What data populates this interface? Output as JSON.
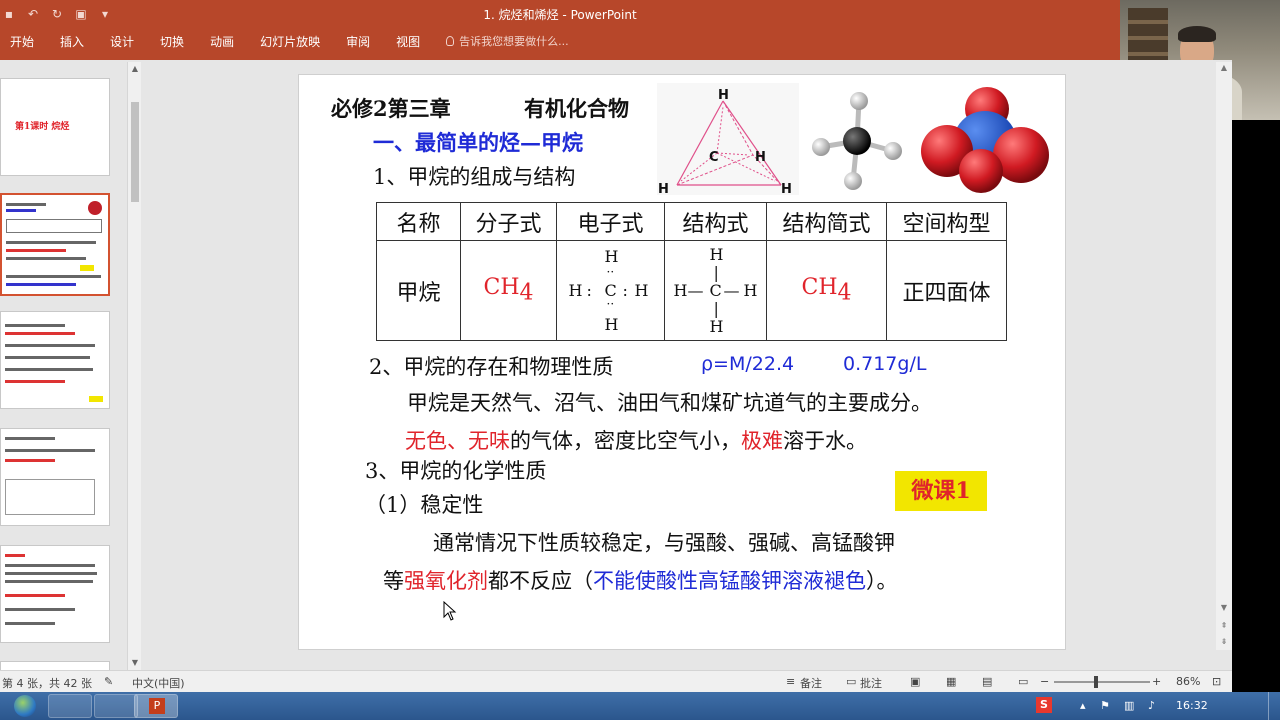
{
  "window": {
    "title": "1. 烷烃和烯烃 - PowerPoint"
  },
  "ribbon": {
    "tabs": [
      "开始",
      "插入",
      "设计",
      "切换",
      "动画",
      "幻灯片放映",
      "审阅",
      "视图"
    ],
    "tell_me": "告诉我您想要做什么..."
  },
  "slide": {
    "chapter": "必修2第三章",
    "chapter_title": "有机化合物",
    "section": "一、最简单的烃—甲烷",
    "point1": "1、甲烷的组成与结构",
    "table": {
      "headers": [
        "名称",
        "分子式",
        "电子式",
        "结构式",
        "结构简式",
        "空间构型"
      ],
      "row": {
        "name": "甲烷",
        "formula_base": "CH",
        "formula_sub": "4",
        "electron_h": "H",
        "electron_c": "C",
        "electron_dots": "··",
        "electron_colon": ":",
        "struct_h": "H",
        "struct_c": "C",
        "struct_bond_h": "—",
        "struct_bond_v": "|",
        "shape": "正四面体"
      }
    },
    "point2": "2、甲烷的存在和物理性质",
    "density_formula": "ρ=M/22.4",
    "density_value": "0.717g/L",
    "line_existence": "甲烷是天然气、沼气、油田气和煤矿坑道气的主要成分。",
    "phys": {
      "colorless": "无色、无味",
      "mid": "的气体，密度比空气小，",
      "hard": "极难",
      "end": "溶于水。"
    },
    "point3": "3、甲烷的化学性质",
    "stability": "（1）稳定性",
    "badge": "微课1",
    "stable_line1": "通常情况下性质较稳定，与强酸、强碱、高锰酸钾",
    "stable_line2_start": "等",
    "strong_oxidizer": "强氧化剂",
    "stable_line2_mid": "都不反应（",
    "no_fade": "不能使酸性高锰酸钾溶液褪色",
    "stable_line2_end": "）。",
    "tetra_labels": {
      "top": "H",
      "center": "C",
      "right": "H",
      "left": "H",
      "bottom_right": "H"
    }
  },
  "thumbnails": {
    "slide1_title": "第1课时 烷烃"
  },
  "status": {
    "slide_count": "第 4 张，共 42 张",
    "language": "中文(中国)",
    "notes": "备注",
    "comments": "批注",
    "zoom": "86%"
  },
  "taskbar": {
    "time": "16:32"
  }
}
